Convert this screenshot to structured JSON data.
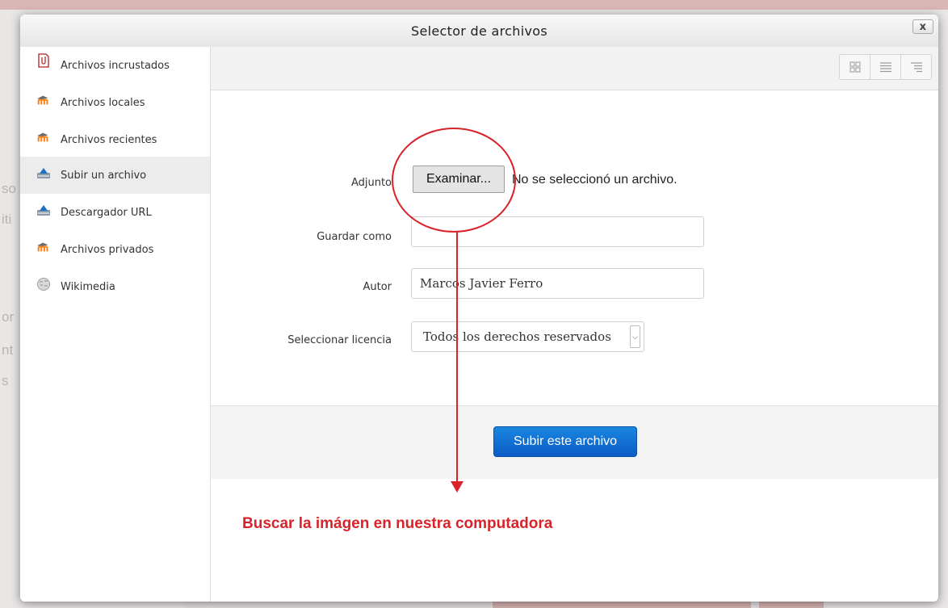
{
  "background": {
    "side_fragments": [
      "so",
      "iti",
      "or",
      "nt",
      "s"
    ]
  },
  "dialog": {
    "title": "Selector de archivos",
    "close_label": "x"
  },
  "sidebar": {
    "items": [
      {
        "label": "Archivos incrustados",
        "icon": "embedded-files-icon"
      },
      {
        "label": "Archivos locales",
        "icon": "moodle-icon"
      },
      {
        "label": "Archivos recientes",
        "icon": "moodle-icon"
      },
      {
        "label": "Subir un archivo",
        "icon": "upload-icon",
        "active": true
      },
      {
        "label": "Descargador URL",
        "icon": "download-url-icon"
      },
      {
        "label": "Archivos privados",
        "icon": "moodle-icon"
      },
      {
        "label": "Wikimedia",
        "icon": "wikimedia-icon"
      }
    ]
  },
  "toolbar": {
    "views": [
      "icons-view",
      "list-view",
      "tree-view"
    ]
  },
  "form": {
    "attachment_label": "Adjunto",
    "browse_button": "Examinar...",
    "no_file_text": "No se seleccionó un archivo.",
    "save_as_label": "Guardar como",
    "save_as_value": "",
    "author_label": "Autor",
    "author_value": "Marcos Javier Ferro",
    "license_label": "Seleccionar licencia",
    "license_value": "Todos los derechos reservados"
  },
  "upload_button": "Subir este archivo",
  "annotation": {
    "text": "Buscar la imágen en nuestra computadora",
    "color": "#d8232a"
  },
  "colors": {
    "accent_blue": "#0b6fd6",
    "annotation_red": "#d8232a",
    "moodle_orange": "#f98012"
  }
}
